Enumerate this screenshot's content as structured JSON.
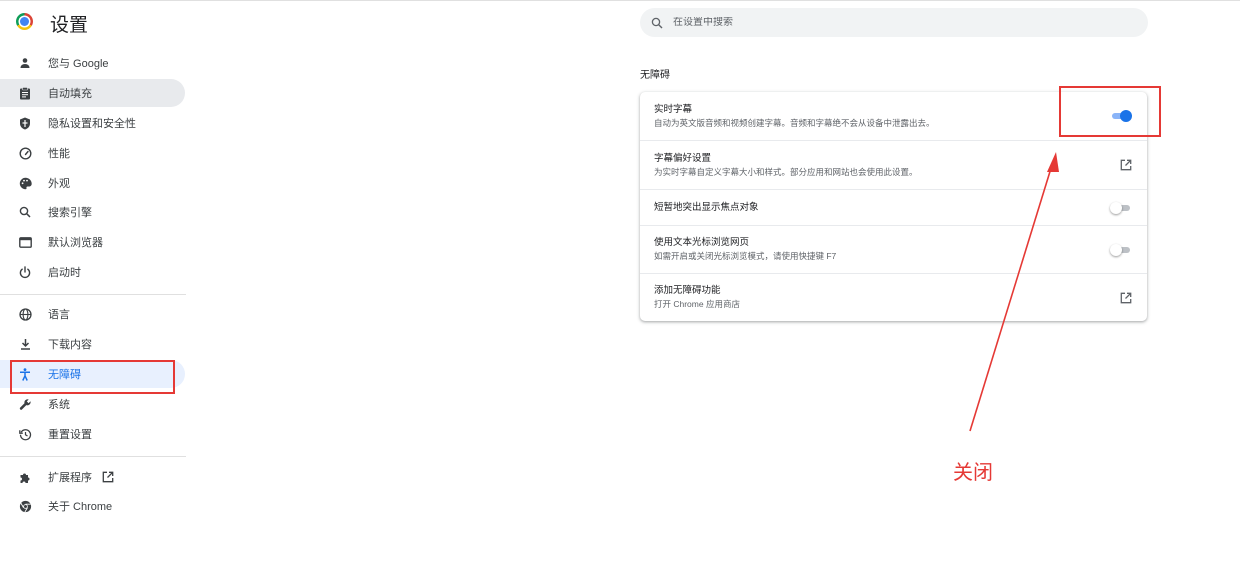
{
  "app": {
    "title": "设置"
  },
  "search": {
    "placeholder": "在设置中搜索"
  },
  "sidebar": {
    "items": [
      {
        "label": "您与 Google",
        "icon": "person-icon"
      },
      {
        "label": "自动填充",
        "icon": "clipboard-icon"
      },
      {
        "label": "隐私设置和安全性",
        "icon": "shield-icon"
      },
      {
        "label": "性能",
        "icon": "speedometer-icon"
      },
      {
        "label": "外观",
        "icon": "palette-icon"
      },
      {
        "label": "搜索引擎",
        "icon": "search-icon"
      },
      {
        "label": "默认浏览器",
        "icon": "browser-window-icon"
      },
      {
        "label": "启动时",
        "icon": "power-icon"
      },
      {
        "label": "语言",
        "icon": "globe-icon"
      },
      {
        "label": "下载内容",
        "icon": "download-icon"
      },
      {
        "label": "无障碍",
        "icon": "accessibility-icon"
      },
      {
        "label": "系统",
        "icon": "wrench-icon"
      },
      {
        "label": "重置设置",
        "icon": "reset-history-icon"
      },
      {
        "label": "扩展程序",
        "icon": "puzzle-icon"
      },
      {
        "label": "关于 Chrome",
        "icon": "chrome-icon"
      }
    ]
  },
  "main": {
    "section_title": "无障碍",
    "rows": [
      {
        "title": "实时字幕",
        "subtitle": "自动为英文版音频和视频创建字幕。音频和字幕绝不会从设备中泄露出去。",
        "control": "toggle",
        "on": true
      },
      {
        "title": "字幕偏好设置",
        "subtitle": "为实时字幕自定义字幕大小和样式。部分应用和网站也会使用此设置。",
        "control": "external-link-icon"
      },
      {
        "title": "短暂地突出显示焦点对象",
        "subtitle": "",
        "control": "toggle",
        "on": false
      },
      {
        "title": "使用文本光标浏览网页",
        "subtitle": "如需开启或关闭光标浏览模式，请使用快捷键 F7",
        "control": "toggle",
        "on": false
      },
      {
        "title": "添加无障碍功能",
        "subtitle": "打开 Chrome 应用商店",
        "control": "external-link-icon"
      }
    ]
  },
  "annotation": {
    "text": "关闭",
    "color": "#e53935"
  },
  "colors": {
    "accent": "#1a73e8",
    "active_bg": "#e8f0fe",
    "selected_bg": "#e8eaed"
  }
}
